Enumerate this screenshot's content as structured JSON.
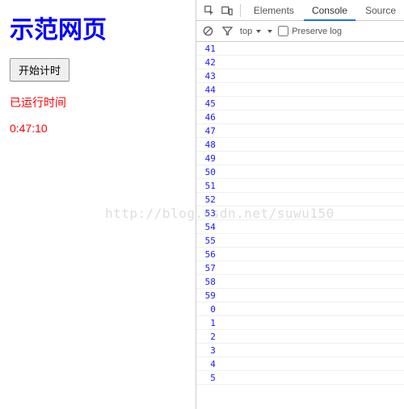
{
  "page": {
    "title": "示范网页",
    "start_button_label": "开始计时",
    "elapsed_label": "已运行时间",
    "elapsed_time": "0:47:10"
  },
  "watermark": "http://blog.csdn.net/suwu150",
  "devtools": {
    "tabs": {
      "elements": "Elements",
      "console": "Console",
      "sources": "Source"
    },
    "active_tab": "console",
    "toolbar": {
      "context_label": "top",
      "preserve_log_label": "Preserve log",
      "preserve_log_checked": false
    },
    "console_lines": [
      "41",
      "42",
      "43",
      "44",
      "45",
      "46",
      "47",
      "48",
      "49",
      "50",
      "51",
      "52",
      "53",
      "54",
      "55",
      "56",
      "57",
      "58",
      "59",
      "0",
      "1",
      "2",
      "3",
      "4",
      "5"
    ]
  }
}
